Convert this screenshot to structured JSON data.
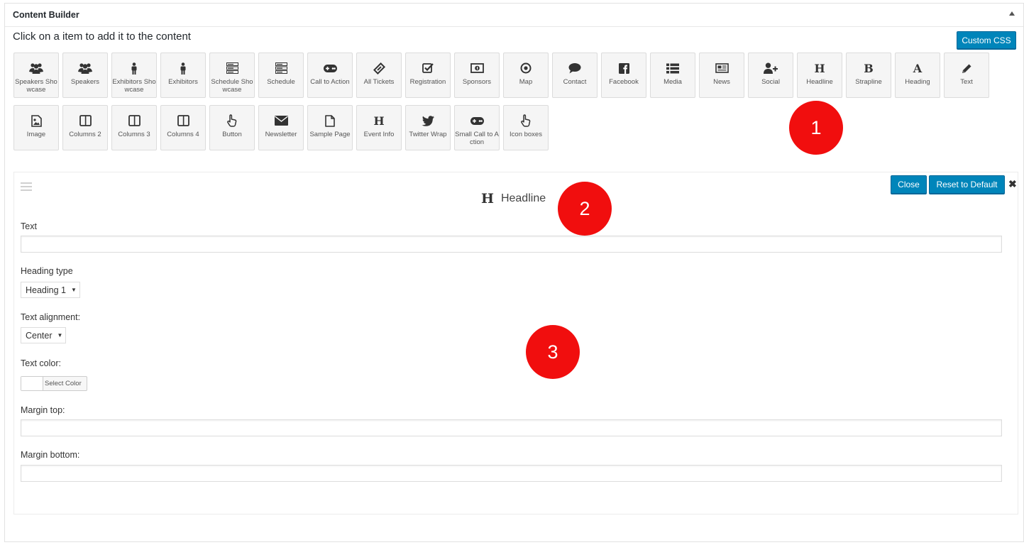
{
  "panel": {
    "title": "Content Builder"
  },
  "instruction": "Click on a item to add it to the content",
  "custom_css_label": "Custom CSS",
  "items": [
    {
      "label": "Speakers Showcase",
      "icon": "group-icon"
    },
    {
      "label": "Speakers",
      "icon": "group-icon"
    },
    {
      "label": "Exhibitors Showcase",
      "icon": "person-icon"
    },
    {
      "label": "Exhibitors",
      "icon": "person-icon"
    },
    {
      "label": "Schedule Showcase",
      "icon": "server-icon"
    },
    {
      "label": "Schedule",
      "icon": "server-icon"
    },
    {
      "label": "Call to Action",
      "icon": "gamepad-icon"
    },
    {
      "label": "All Tickets",
      "icon": "ticket-icon"
    },
    {
      "label": "Registration",
      "icon": "check-square-icon"
    },
    {
      "label": "Sponsors",
      "icon": "money-icon"
    },
    {
      "label": "Map",
      "icon": "target-icon"
    },
    {
      "label": "Contact",
      "icon": "comment-icon"
    },
    {
      "label": "Facebook",
      "icon": "facebook-icon"
    },
    {
      "label": "Media",
      "icon": "list-icon"
    },
    {
      "label": "News",
      "icon": "newspaper-icon"
    },
    {
      "label": "Social",
      "icon": "user-plus-icon"
    },
    {
      "label": "Headline",
      "icon": "letter-h-icon",
      "letter": "H"
    },
    {
      "label": "Strapline",
      "icon": "letter-b-icon",
      "letter": "B"
    },
    {
      "label": "Heading",
      "icon": "letter-a-icon",
      "letter": "A"
    },
    {
      "label": "Text",
      "icon": "pencil-icon"
    },
    {
      "label": "Image",
      "icon": "image-icon"
    },
    {
      "label": "Columns 2",
      "icon": "columns-icon"
    },
    {
      "label": "Columns 3",
      "icon": "columns-icon"
    },
    {
      "label": "Columns 4",
      "icon": "columns-icon"
    },
    {
      "label": "Button",
      "icon": "pointer-icon"
    },
    {
      "label": "Newsletter",
      "icon": "envelope-icon"
    },
    {
      "label": "Sample Page",
      "icon": "file-icon"
    },
    {
      "label": "Event Info",
      "icon": "letter-h-icon",
      "letter": "H"
    },
    {
      "label": "Twitter Wrap",
      "icon": "twitter-icon"
    },
    {
      "label": "Small Call to Action",
      "icon": "gamepad-icon"
    },
    {
      "label": "Icon boxes",
      "icon": "pointer-icon"
    }
  ],
  "markers": [
    "1",
    "2",
    "3"
  ],
  "editor": {
    "title_icon_letter": "H",
    "title": "Headline",
    "close_label": "Close",
    "reset_label": "Reset to Default",
    "fields": {
      "text_label": "Text",
      "text_value": "",
      "heading_type_label": "Heading type",
      "heading_type_value": "Heading 1",
      "alignment_label": "Text alignment:",
      "alignment_value": "Center",
      "color_label": "Text color:",
      "color_button": "Select Color",
      "margin_top_label": "Margin top:",
      "margin_top_value": "",
      "margin_bottom_label": "Margin bottom:",
      "margin_bottom_value": ""
    }
  },
  "colors": {
    "accent": "#0085ba",
    "marker": "#f10e0e"
  }
}
